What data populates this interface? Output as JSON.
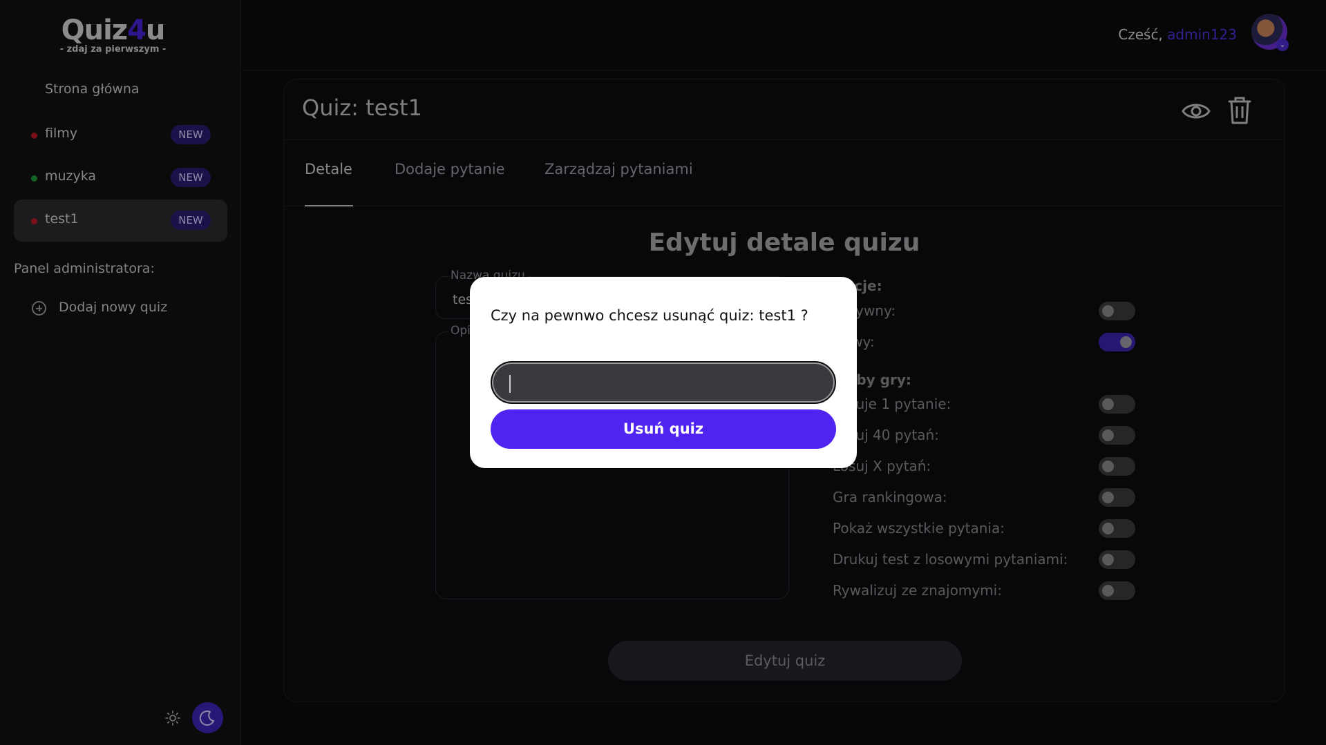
{
  "sidebar": {
    "logo_main_a": "Quiz",
    "logo_main_accent": "4",
    "logo_main_b": "u",
    "logo_sub": "- zdaj za pierwszym -",
    "home": "Strona główna",
    "categories": [
      {
        "label": "filmy",
        "badge": "NEW",
        "dot_color": "#c0182a"
      },
      {
        "label": "muzyka",
        "badge": "NEW",
        "dot_color": "#1f9a3a"
      },
      {
        "label": "test1",
        "badge": "NEW",
        "dot_color": "#c0182a"
      }
    ],
    "admin_label": "Panel administratora:",
    "add_quiz": "Dodaj nowy quiz"
  },
  "header": {
    "greeting": "Cześć, ",
    "username": "admin123"
  },
  "card": {
    "title": "Quiz: test1",
    "tabs": [
      "Detale",
      "Dodaje pytanie",
      "Zarządzaj pytaniami"
    ],
    "form_title": "Edytuj detale quizu",
    "name_label": "Nazwa quizu",
    "name_value": "test1",
    "desc_label": "Opis",
    "options_head": "Opcje:",
    "opt_active": "Aktywny:",
    "opt_new": "Nowy:",
    "modes_head": "Tryby gry:",
    "modes": [
      {
        "label": "Losuje 1 pytanie:",
        "on": false
      },
      {
        "label": "Losuj 40 pytań:",
        "on": false
      },
      {
        "label": "Losuj X pytań:",
        "on": false
      },
      {
        "label": "Gra rankingowa:",
        "on": false
      },
      {
        "label": "Pokaż wszystkie pytania:",
        "on": false
      },
      {
        "label": "Drukuj test z losowymi pytaniami:",
        "on": false
      },
      {
        "label": "Rywalizuj ze znajomymi:",
        "on": false
      }
    ],
    "active_on": false,
    "new_on": true,
    "edit_button": "Edytuj quiz"
  },
  "modal": {
    "question": "Czy na pewnwo chcesz usunąć quiz: test1 ?",
    "input_value": "",
    "button": "Usuń quiz"
  },
  "colors": {
    "accent": "#5024f0",
    "username": "#4f30e0",
    "badge_bg": "#2a1d70"
  }
}
